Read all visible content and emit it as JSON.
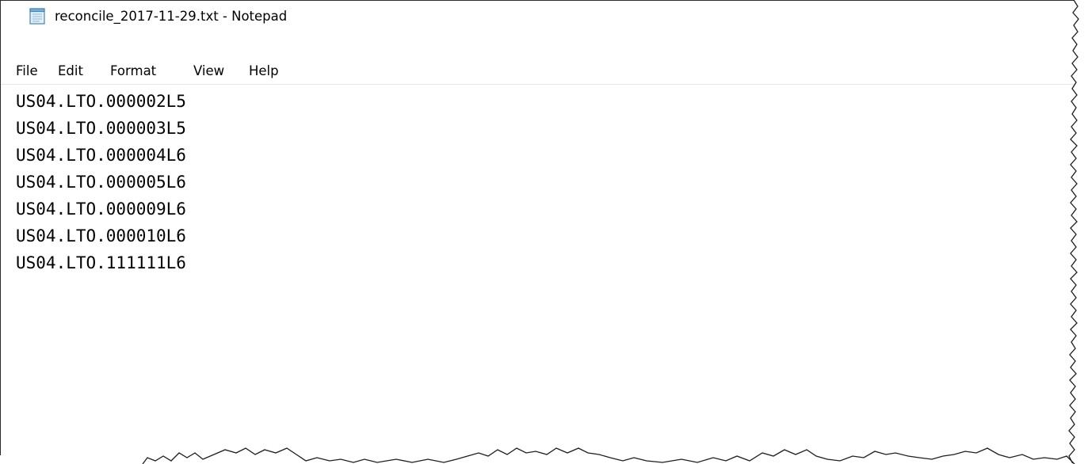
{
  "window": {
    "title": "reconcile_2017-11-29.txt - Notepad",
    "app_icon": "notepad-icon"
  },
  "menu": {
    "items": [
      {
        "label": "File"
      },
      {
        "label": "Edit"
      },
      {
        "label": "Format"
      },
      {
        "label": "View"
      },
      {
        "label": "Help"
      }
    ]
  },
  "editor": {
    "lines": [
      "US04.LTO.000002L5",
      "US04.LTO.000003L5",
      "US04.LTO.000004L6",
      "US04.LTO.000005L6",
      "US04.LTO.000009L6",
      "US04.LTO.000010L6",
      "US04.LTO.111111L6"
    ]
  },
  "colors": {
    "text": "#000000",
    "background": "#ffffff",
    "menu_separator": "#e5e5e5"
  }
}
